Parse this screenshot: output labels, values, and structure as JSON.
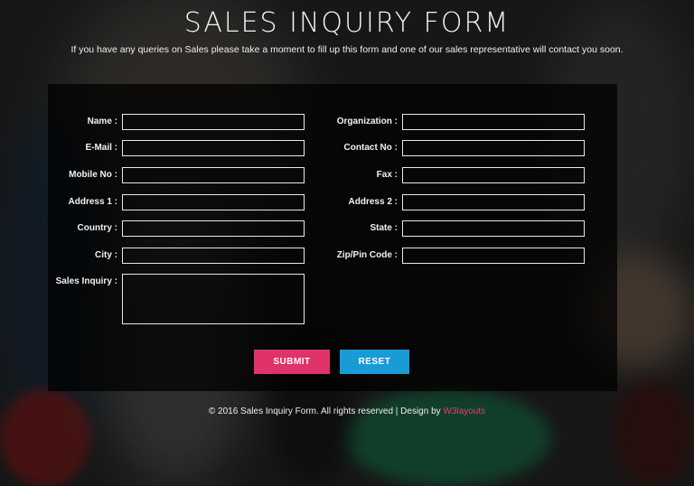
{
  "header": {
    "title": "SALES INQUIRY FORM",
    "subtitle": "If you have any queries on Sales please take a moment to fill up this form and one of our sales representative will contact you soon."
  },
  "form": {
    "left": {
      "name": "Name :",
      "email": "E-Mail :",
      "mobile": "Mobile No :",
      "address1": "Address 1 :",
      "country": "Country :",
      "city": "City :",
      "inquiry": "Sales Inquiry :"
    },
    "right": {
      "organization": "Organization :",
      "contact": "Contact No :",
      "fax": "Fax :",
      "address2": "Address 2 :",
      "state": "State :",
      "zip": "Zip/Pin Code :"
    },
    "buttons": {
      "submit": "SUBMIT",
      "reset": "RESET"
    }
  },
  "footer": {
    "text": "© 2016 Sales Inquiry Form. All rights reserved | Design by ",
    "brand": "W3layouts"
  },
  "colors": {
    "submit": "#e0336a",
    "reset": "#199bd6",
    "brand": "#e83b6c"
  }
}
